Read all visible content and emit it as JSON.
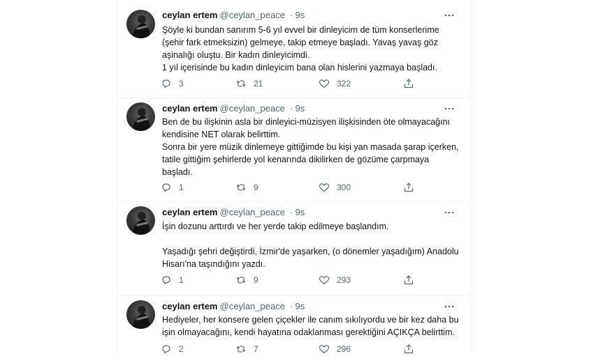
{
  "tweets": [
    {
      "name": "ceylan ertem",
      "handle": "@ceylan_peace",
      "time": "· 9s",
      "text": "Şöyle ki bundan sanırım 5-6 yıl evvel bir dinleyicim de tüm konserlerime\n(şehir fark etmeksizin) gelmeye, takip etmeye başladı. Yavaş yavaş göz\naşinalığı oluştu. Bir kadın dinleyicimdi.\n1 yıl içerisinde bu kadın dinleyicim bana olan hislerini yazmaya başladı.",
      "replies": "3",
      "retweets": "21",
      "likes": "322"
    },
    {
      "name": "ceylan ertem",
      "handle": "@ceylan_peace",
      "time": "· 9s",
      "text": "Ben de bu ilişkinin asla bir dinleyici-müzisyen ilişkisinden öte olmayacağını\nkendisine NET olarak belirttim.\nSonra bir yere müzik dinlemeye gittiğimde bu kişi yan masada şarap içerken,\ntatile gittiğim şehirlerde yol kenarında dikilirken de gözüme çarpmaya\nbaşladı.",
      "replies": "1",
      "retweets": "9",
      "likes": "300"
    },
    {
      "name": "ceylan ertem",
      "handle": "@ceylan_peace",
      "time": "· 9s",
      "text": "İşin dozunu arttırdı ve her yerde takip edilmeye başlandım.\n\nYaşadığı şehri değiştirdi, İzmir'de yaşarken, (o dönemler yaşadığım) Anadolu\nHisarı'na taşındığını yazdı.",
      "replies": "1",
      "retweets": "9",
      "likes": "293"
    },
    {
      "name": "ceylan ertem",
      "handle": "@ceylan_peace",
      "time": "· 9s",
      "text": "Hediyeler, her konsere gelen çiçekler ile canım sıkılıyordu ve bir kez daha bu\nişin olmayacağını, kendi hayatına odaklanması gerektiğini AÇIKÇA belirttim.",
      "replies": "2",
      "retweets": "7",
      "likes": "296"
    }
  ],
  "icons": {
    "reply": "reply-icon",
    "retweet": "retweet-icon",
    "like": "like-icon",
    "share": "share-icon",
    "more": "more-icon"
  },
  "colors": {
    "text": "#0f1419",
    "secondary": "#536471",
    "divider": "#eff3f4"
  }
}
